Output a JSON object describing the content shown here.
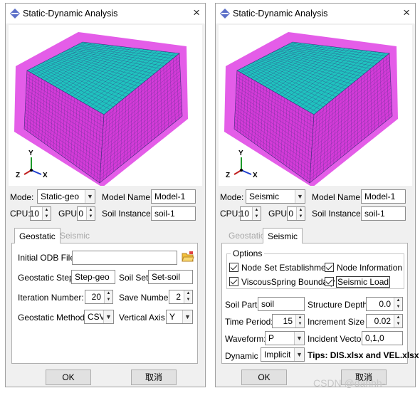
{
  "colors": {
    "mesh_top": "#1fc3bf",
    "mesh_side": "#d43bd8",
    "mesh_outer": "#e14be5",
    "mesh_lines": "#3a2e7a"
  },
  "left": {
    "title": "Static-Dynamic Analysis",
    "close": "×",
    "axes": {
      "y": "Y",
      "z": "Z",
      "x": "X"
    },
    "mode_label": "Mode:",
    "mode_value": "Static-geo",
    "model_name_label": "Model Name:",
    "model_name_value": "Model-1",
    "cpu_label": "CPU:",
    "cpu_value": "10",
    "gpu_label": "GPU:",
    "gpu_value": "0",
    "soil_instance_label": "Soil Instance :",
    "soil_instance_value": "soil-1",
    "tabs": [
      "Geostatic",
      "Seismic"
    ],
    "initial_odb_label": "Initial ODB File:",
    "initial_odb_value": "",
    "geostatic_step_label": "Geostatic Step:",
    "geostatic_step_value": "Step-geo",
    "soil_set_label": "Soil Set:",
    "soil_set_value": "Set-soil",
    "iteration_label": "Iteration Number:",
    "iteration_value": "20",
    "save_number_label": "Save Number:",
    "save_number_value": "2",
    "method_label": "Geostatic Method:",
    "method_value": "CSV",
    "vertical_axis_label": "Vertical Axis :",
    "vertical_axis_value": "Y",
    "ok": "OK",
    "cancel": "取消"
  },
  "right": {
    "title": "Static-Dynamic Analysis",
    "close": "×",
    "axes": {
      "y": "Y",
      "z": "Z",
      "x": "X"
    },
    "mode_label": "Mode:",
    "mode_value": "Seismic",
    "model_name_label": "Model Name:",
    "model_name_value": "Model-1",
    "cpu_label": "CPU:",
    "cpu_value": "10",
    "gpu_label": "GPU:",
    "gpu_value": "0",
    "soil_instance_label": "Soil Instance :",
    "soil_instance_value": "soil-1",
    "tabs": [
      "Geostatic",
      "Seismic"
    ],
    "options_title": "Options",
    "cb_node_set": "Node Set Establishment",
    "cb_node_info": "Node Information",
    "cb_viscous": "ViscousSpring Boundary",
    "cb_seismic_load": "Seismic Load",
    "soil_part_label": "Soil Part:",
    "soil_part_value": "soil",
    "structure_depth_label": "Structure Depth:",
    "structure_depth_value": "0.0",
    "time_period_label": "Time Period:",
    "time_period_value": "15",
    "increment_label": "Increment Size :",
    "increment_value": "0.02",
    "waveform_label": "Waveform:",
    "waveform_value": "P",
    "incident_label": "Incident Vector:",
    "incident_value": "0,1,0",
    "dynamic_label": "Dynamic :",
    "dynamic_value": "Implicit",
    "tips": "Tips: DIS.xlsx and VEL.xlsx",
    "ok": "OK",
    "cancel": "取消"
  },
  "watermark": "CSDN @dahhh-"
}
